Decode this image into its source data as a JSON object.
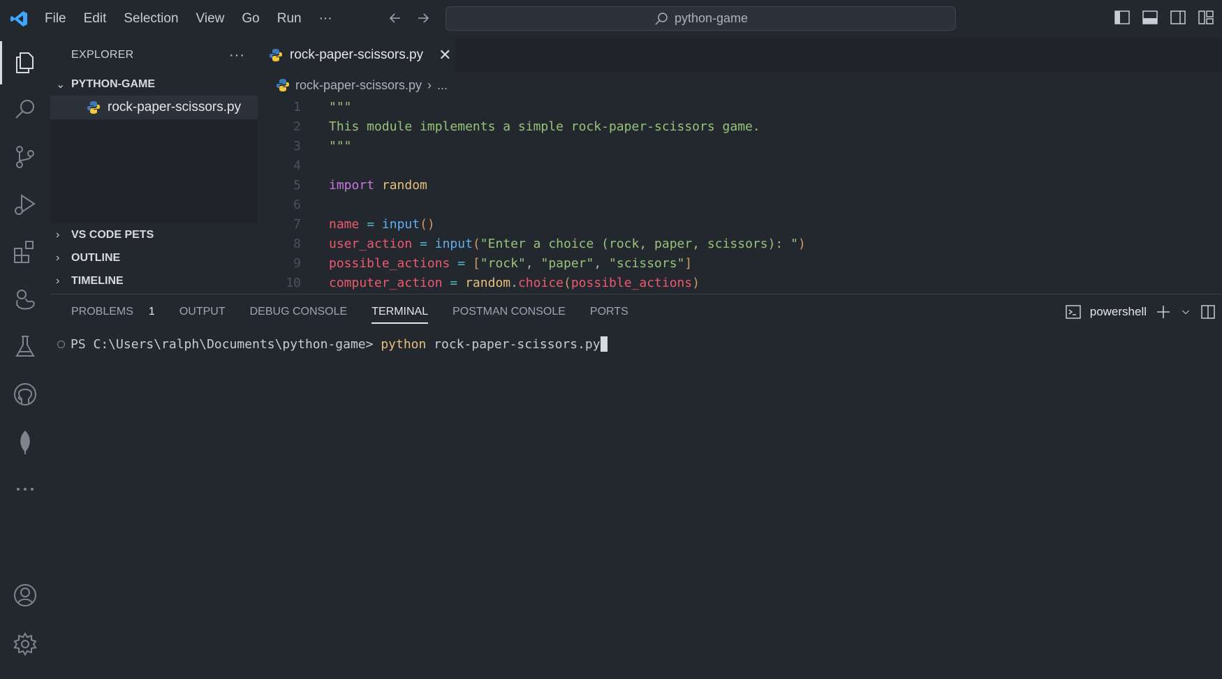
{
  "titlebar": {
    "menu": [
      "File",
      "Edit",
      "Selection",
      "View",
      "Go",
      "Run",
      "···"
    ],
    "search_text": "python-game"
  },
  "sidebar": {
    "header": "EXPLORER",
    "more": "···",
    "folder": "PYTHON-GAME",
    "file": "rock-paper-scissors.py",
    "sections": [
      "VS CODE PETS",
      "OUTLINE",
      "TIMELINE"
    ]
  },
  "editor": {
    "tab_label": "rock-paper-scissors.py",
    "breadcrumb_file": "rock-paper-scissors.py",
    "breadcrumb_more": "...",
    "line_numbers": [
      "1",
      "2",
      "3",
      "4",
      "5",
      "6",
      "7",
      "8",
      "9",
      "10"
    ],
    "code": {
      "l1": "\"\"\"",
      "l2": "This module implements a simple rock-paper-scissors game.",
      "l3": "\"\"\"",
      "l5_kw": "import",
      "l5_mod": "random",
      "l7_var": "name",
      "l7_op": "=",
      "l7_fn": "input",
      "l7_paren": "()",
      "l8_var": "user_action",
      "l8_op": "=",
      "l8_fn": "input",
      "l8_p1": "(",
      "l8_str": "\"Enter a choice (rock, paper, scissors): \"",
      "l8_p2": ")",
      "l9_var": "possible_actions",
      "l9_op": "=",
      "l9_b1": "[",
      "l9_s1": "\"rock\"",
      "l9_c1": ", ",
      "l9_s2": "\"paper\"",
      "l9_c2": ", ",
      "l9_s3": "\"scissors\"",
      "l9_b2": "]",
      "l10_var": "computer_action",
      "l10_op": "=",
      "l10_mod": "random",
      "l10_dot": ".",
      "l10_fn": "choice",
      "l10_p1": "(",
      "l10_arg": "possible_actions",
      "l10_p2": ")"
    }
  },
  "panel": {
    "tabs": [
      "PROBLEMS",
      "OUTPUT",
      "DEBUG CONSOLE",
      "TERMINAL",
      "POSTMAN CONSOLE",
      "PORTS"
    ],
    "problems_count": "1",
    "active_tab": "TERMINAL",
    "shell": "powershell",
    "prompt": "PS C:\\Users\\ralph\\Documents\\python-game> ",
    "command": "python",
    "command_arg": " rock-paper-scissors.py"
  },
  "colors": {
    "accent": "#3ea6ff",
    "background": "#23272e",
    "string": "#98c379",
    "keyword": "#c678dd",
    "variable": "#ef596f"
  }
}
